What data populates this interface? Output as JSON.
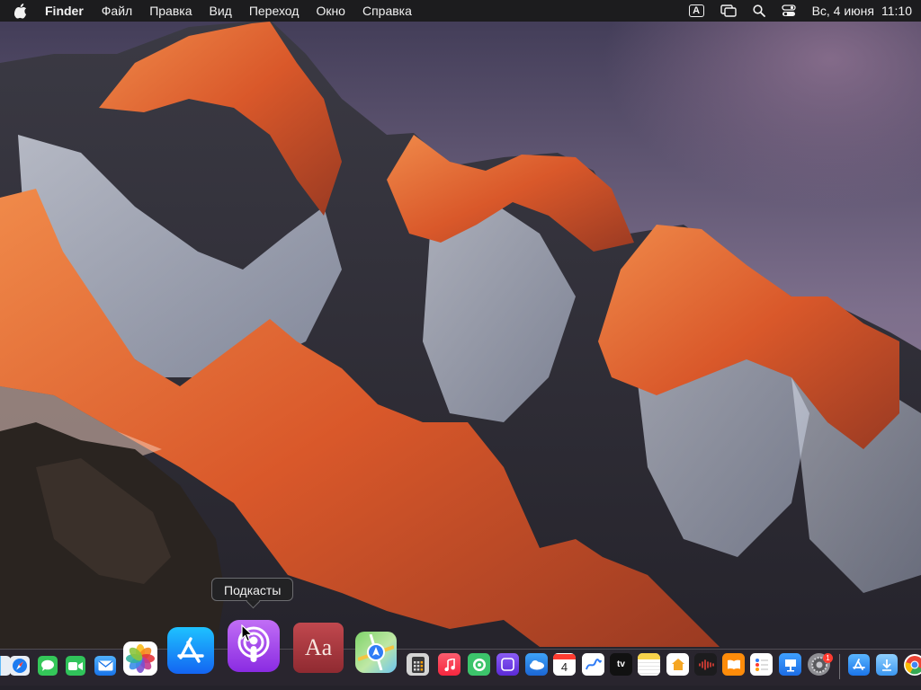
{
  "menubar": {
    "app_name": "Finder",
    "items": [
      "Файл",
      "Правка",
      "Вид",
      "Переход",
      "Окно",
      "Справка"
    ],
    "keyboard_layout": "A",
    "date": "Вс, 4 июня",
    "time": "11:10"
  },
  "tooltip": {
    "label": "Подкасты"
  },
  "dock": {
    "calendar_day": "4",
    "tv_label": "tv",
    "dictionary_label": "Aa",
    "settings_badge": "1",
    "icons": [
      "finder-icon",
      "safari-icon",
      "messages-icon",
      "facetime-icon",
      "mail-icon",
      "photos-icon",
      "app-store-icon",
      "podcasts-icon",
      "dictionary-icon",
      "maps-icon",
      "calculator-icon",
      "music-icon",
      "find-my-icon",
      "screen-time-icon",
      "weather-icon",
      "calendar-icon",
      "freeform-icon",
      "tv-icon",
      "notes-icon",
      "home-icon",
      "voice-memos-icon",
      "books-icon",
      "reminders-icon",
      "keynote-icon",
      "settings-icon",
      "applications-folder-icon",
      "downloads-folder-icon",
      "chrome-icon"
    ]
  },
  "colors": {
    "menubar_bg": "#1c1c1e",
    "tooltip_bg": "#222224",
    "sky_top": "#4a4560",
    "rock_orange": "#e8692a"
  }
}
